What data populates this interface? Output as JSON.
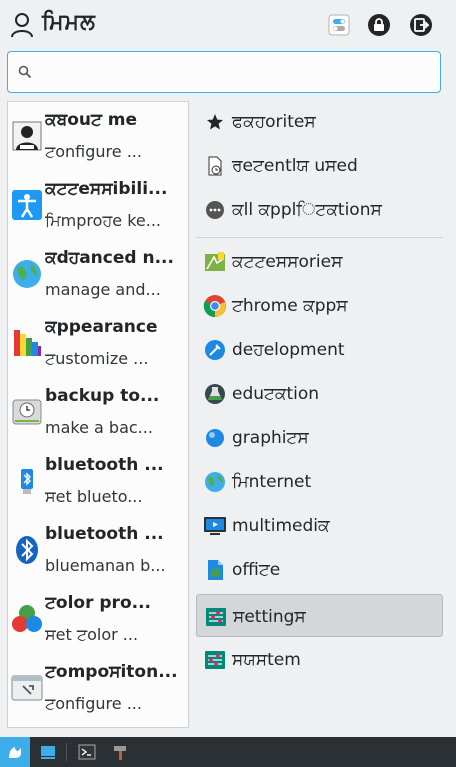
{
  "header": {
    "username": "ਮਿਮਲ"
  },
  "search": {
    "placeholder": "",
    "value": ""
  },
  "favorites": [
    {
      "title": "ਕਬouਟ me",
      "subtitle": "ਟonfigure ...",
      "icon": "about-me-icon"
    },
    {
      "title": "ਕਟਟeਸਸibili...",
      "subtitle": "ਮਿmproਹe ke...",
      "icon": "accessibility-icon"
    },
    {
      "title": "ਕdਹanced n...",
      "subtitle": "manage and...",
      "icon": "globe-icon"
    },
    {
      "title": "ਕppearance",
      "subtitle": "ਟustomize ...",
      "icon": "appearance-icon"
    },
    {
      "title": "backup to...",
      "subtitle": "make a bac...",
      "icon": "backup-drive-icon"
    },
    {
      "title": "bluetooth ...",
      "subtitle": "ਸet blueto...",
      "icon": "bluetooth-usb-icon"
    },
    {
      "title": "bluetooth ...",
      "subtitle": "bluemanan b...",
      "icon": "bluetooth-icon"
    },
    {
      "title": "ਟolor pro...",
      "subtitle": "ਸet ਟolor ...",
      "icon": "color-profile-icon"
    },
    {
      "title": "ਟompoਸiton...",
      "subtitle": "ਟonfigure ...",
      "icon": "compositor-icon"
    }
  ],
  "categories": [
    {
      "label": "ਫਕਹoriteਸ",
      "icon": "star-icon",
      "selected": false
    },
    {
      "label": "ਰeਟentlਯ uਸed",
      "icon": "recent-doc-icon",
      "selected": false
    },
    {
      "label": "ਕll ਕpplਿਟਕtionਸ",
      "icon": "more-dots-icon",
      "selected": false
    },
    {
      "label": "ਕਟਟeਸਸorieਸ",
      "icon": "accessories-icon",
      "selected": false
    },
    {
      "label": "ਟhrome ਕppਸ",
      "icon": "chrome-icon",
      "selected": false
    },
    {
      "label": "deਹelopment",
      "icon": "development-icon",
      "selected": false
    },
    {
      "label": "eduਟਕtion",
      "icon": "education-icon",
      "selected": false
    },
    {
      "label": "graphiਟਸ",
      "icon": "graphics-icon",
      "selected": false
    },
    {
      "label": "ਮਿnternet",
      "icon": "internet-icon",
      "selected": false
    },
    {
      "label": "multimediਕ",
      "icon": "multimedia-icon",
      "selected": false
    },
    {
      "label": "offiਟe",
      "icon": "office-icon",
      "selected": false
    },
    {
      "label": "ਸettingਸ",
      "icon": "settings-icon",
      "selected": true
    },
    {
      "label": "ਸਯਸtem",
      "icon": "system-icon",
      "selected": false
    }
  ],
  "colors": {
    "accent": "#3daee9",
    "background": "#eff0f1",
    "taskbar": "#2b3035",
    "selected": "#d4d6d8"
  },
  "taskbar": [
    {
      "name": "app-launcher-icon",
      "active": true
    },
    {
      "name": "desktop-icon",
      "active": false
    },
    {
      "name": "terminal-icon",
      "active": false
    },
    {
      "name": "hammer-icon",
      "active": false
    }
  ]
}
